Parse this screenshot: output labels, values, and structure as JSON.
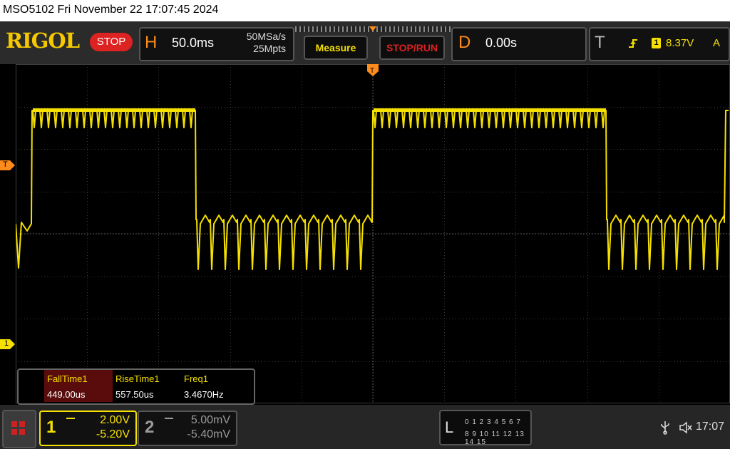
{
  "title_bar": {
    "text": "MSO5102  Fri November 22 17:07:45 2024"
  },
  "header": {
    "logo": "RIGOL",
    "run_state": "STOP",
    "horizontal": {
      "letter": "H",
      "timebase": "50.0ms",
      "sample_rate": "50MSa/s",
      "memory_depth": "25Mpts"
    },
    "measure_button": "Measure",
    "stoprun_button": "STOP/RUN",
    "delay": {
      "letter": "D",
      "value": "0.00s"
    },
    "trigger": {
      "letter": "T",
      "channel": "1",
      "level": "8.37V",
      "mode": "A"
    }
  },
  "markers": {
    "trigger_level": "T",
    "channel1_offset": "1"
  },
  "measurements": {
    "headers": [
      "FallTime1",
      "RiseTime1",
      "Freq1"
    ],
    "values": [
      "449.00us",
      "557.50us",
      "3.4670Hz"
    ]
  },
  "channels": [
    {
      "number": "1",
      "scale": "2.00V",
      "offset": "-5.20V",
      "color": "#f5e000"
    },
    {
      "number": "2",
      "scale": "5.00mV",
      "offset": "-5.40mV",
      "color": "#9a9a9a"
    }
  ],
  "logic": {
    "letter": "L",
    "row1": "0 1 2 3   4 5 6 7",
    "row2": "8 9 10 11  12 13 14 15"
  },
  "status": {
    "clock": "17:07"
  },
  "colors": {
    "trace": "#f5e000",
    "accent": "#ff8c1a",
    "stop": "#d22222"
  }
}
